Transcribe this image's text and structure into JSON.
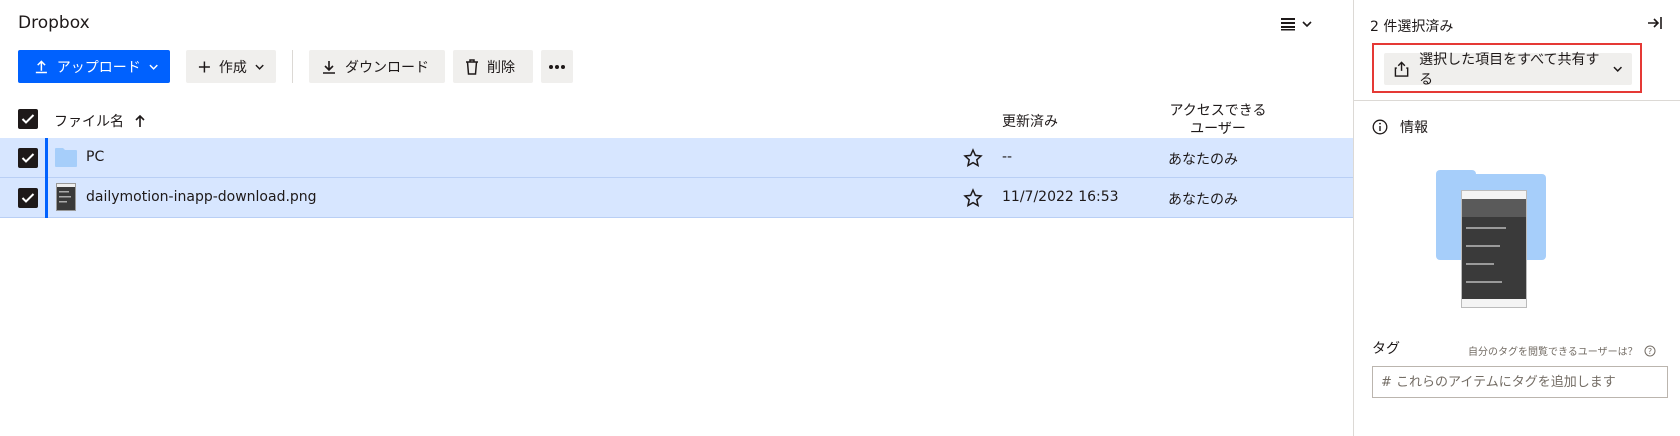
{
  "app": {
    "title": "Dropbox"
  },
  "toolbar": {
    "upload_label": "アップロード",
    "create_label": "作成",
    "download_label": "ダウンロード",
    "delete_label": "削除"
  },
  "table": {
    "headers": {
      "name": "ファイル名",
      "modified": "更新済み",
      "access_line1": "アクセスできる",
      "access_line2": "ユーザー"
    },
    "rows": [
      {
        "name": "PC",
        "modified": "--",
        "access": "あなたのみ",
        "type": "folder"
      },
      {
        "name": "dailymotion-inapp-download.png",
        "modified": "11/7/2022 16:53",
        "access": "あなたのみ",
        "type": "image"
      }
    ]
  },
  "sidebar": {
    "selection_count": "2 件選択済み",
    "share_label": "選択した項目をすべて共有する",
    "info_label": "情報",
    "tags_label": "タグ",
    "tags_hint": "自分のタグを閲覧できるユーザーは？",
    "tag_placeholder": "# これらのアイテムにタグを追加します"
  },
  "colors": {
    "accent": "#0061fe",
    "selected_row": "#d7e6ff",
    "highlight_border": "#e53935"
  }
}
